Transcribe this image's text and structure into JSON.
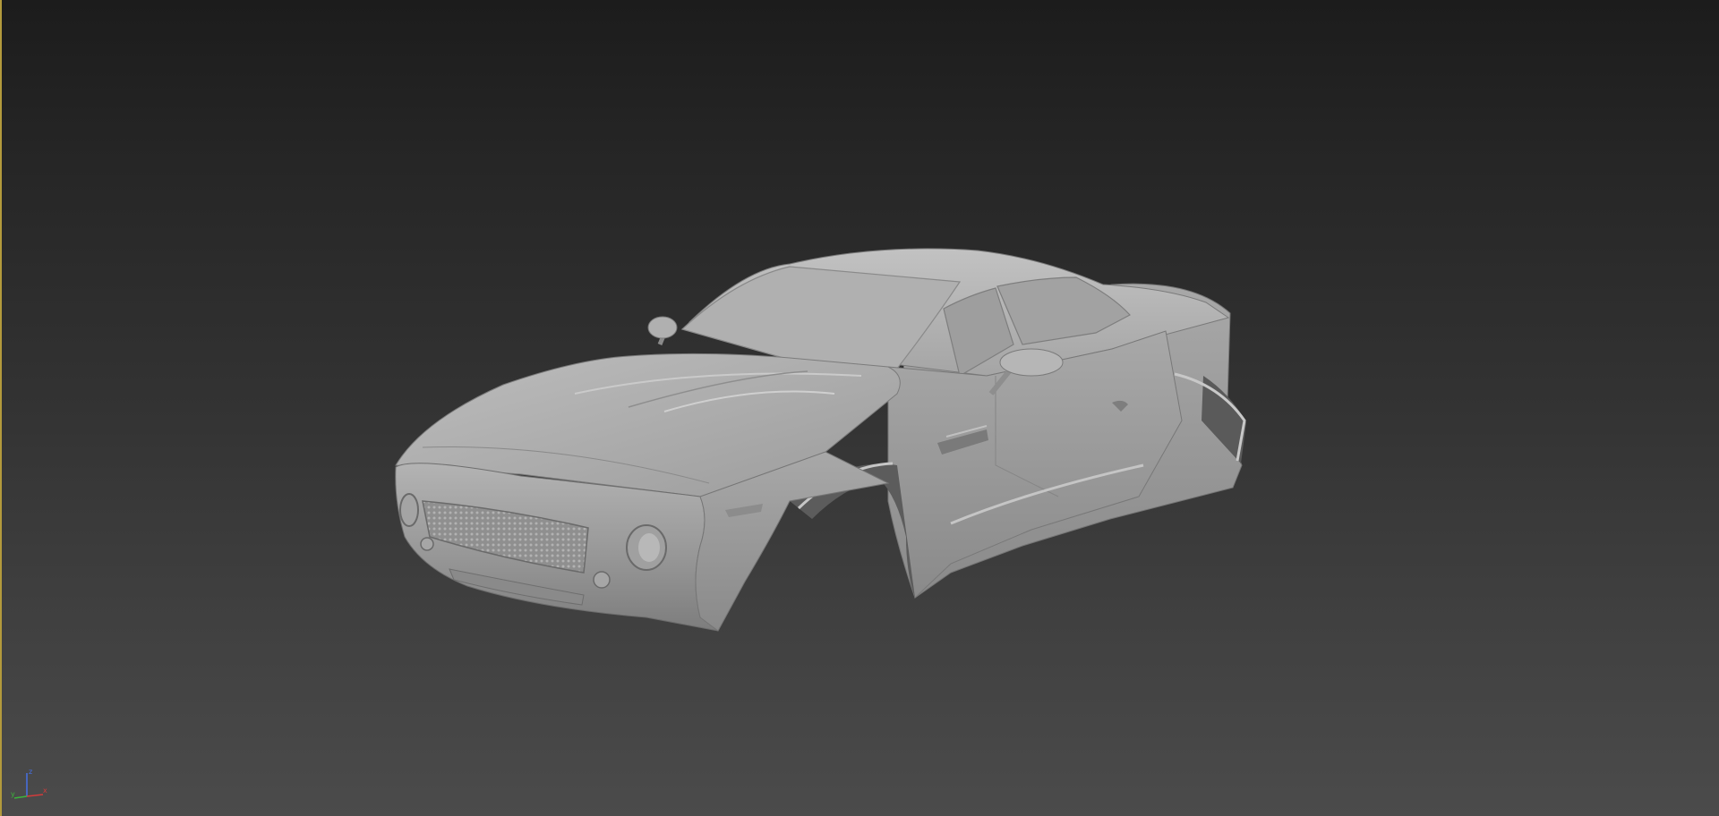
{
  "viewport": {
    "border_color": "#b39a3c",
    "background_top": "#1c1c1c",
    "background_bottom": "#4b4b4b",
    "model_color": "#9a9a9a"
  },
  "gizmo": {
    "x_label": "x",
    "y_label": "y",
    "z_label": "z",
    "x_color": "#d23c3c",
    "y_color": "#3cb43c",
    "z_color": "#4670e6"
  }
}
